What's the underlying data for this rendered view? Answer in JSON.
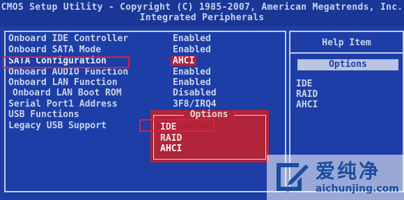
{
  "header": {
    "line1": "CMOS Setup Utility - Copyright (C) 1985-2007, American Megatrends, Inc.",
    "line2": "Integrated Peripherals"
  },
  "settings": [
    {
      "label": "Onboard IDE Controller",
      "value": "Enabled"
    },
    {
      "label": "Onboard SATA Mode",
      "value": "Enabled"
    },
    {
      "label": "SATA Configuration",
      "value": "AHCI"
    },
    {
      "label": "Onboard AUDIO Function",
      "value": "Enabled"
    },
    {
      "label": "Onboard LAN Function",
      "value": "Enabled"
    },
    {
      "label": "Onboard LAN Boot ROM",
      "value": "Disabled"
    },
    {
      "label": "Serial Port1 Address",
      "value": "3F8/IRQ4"
    },
    {
      "label": "USB Functions",
      "value": ""
    },
    {
      "label": "Legacy USB Support",
      "value": ""
    }
  ],
  "help": {
    "title": "Help Item",
    "options_label": "Options",
    "items": [
      "IDE",
      "RAID",
      "AHCI"
    ]
  },
  "popup": {
    "title": "Options",
    "items": [
      "IDE",
      "RAID",
      "AHCI"
    ],
    "selected": "AHCI"
  },
  "watermark": {
    "cn": "爱纯净",
    "url": "aichunjing.com"
  },
  "colors": {
    "background": "#1d3ea6",
    "text": "#c9d3ef",
    "highlight": "#b41e3a",
    "annotation": "#d6243d"
  }
}
